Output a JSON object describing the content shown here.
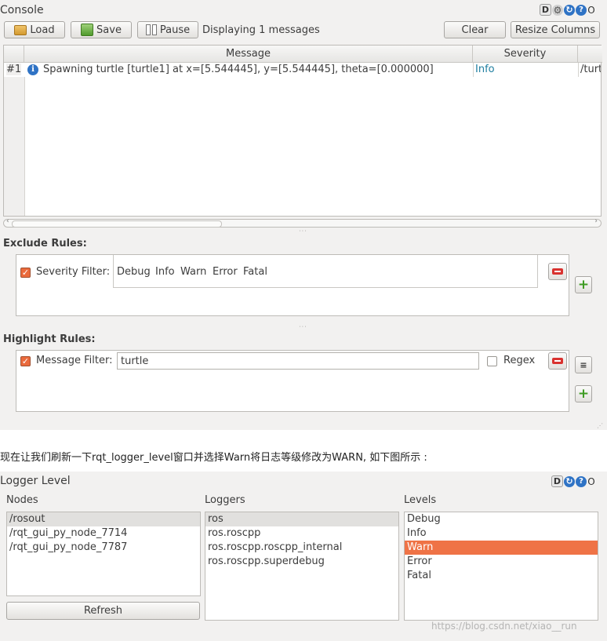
{
  "console": {
    "title": "Console",
    "buttons": {
      "load": "Load",
      "save": "Save",
      "pause": "Pause",
      "clear": "Clear",
      "resize": "Resize Columns"
    },
    "status": "Displaying 1 messages",
    "columns": {
      "message": "Message",
      "severity": "Severity"
    },
    "rows": [
      {
        "num": "#1",
        "message": "Spawning turtle [turtle1] at x=[5.544445], y=[5.544445], theta=[0.000000]",
        "severity": "Info",
        "node": "/turt"
      }
    ],
    "header_icons": {
      "d": "D",
      "gear": "gear-icon",
      "refresh": "refresh-icon",
      "help": "?",
      "close": "O"
    }
  },
  "exclude": {
    "label": "Exclude Rules:",
    "filter_label": "Severity Filter:",
    "levels": [
      "Debug",
      "Info",
      "Warn",
      "Error",
      "Fatal"
    ]
  },
  "highlight": {
    "label": "Highlight Rules:",
    "filter_label": "Message Filter:",
    "value": "turtle",
    "regex_label": "Regex"
  },
  "caption": "现在让我们刷新一下rqt_logger_level窗口并选择Warn将日志等级修改为WARN, 如下图所示 :",
  "logger": {
    "title": "Logger Level",
    "header_icons": {
      "d": "D",
      "refresh": "refresh-icon",
      "help": "?",
      "close": "O"
    },
    "nodes_label": "Nodes",
    "nodes": [
      "/rosout",
      "/rqt_gui_py_node_7714",
      "/rqt_gui_py_node_7787"
    ],
    "loggers_label": "Loggers",
    "loggers": [
      "ros",
      "ros.roscpp",
      "ros.roscpp.roscpp_internal",
      "ros.roscpp.superdebug"
    ],
    "levels_label": "Levels",
    "levels": [
      "Debug",
      "Info",
      "Warn",
      "Error",
      "Fatal"
    ],
    "refresh": "Refresh"
  },
  "watermark": "https://blog.csdn.net/xiao__run",
  "colors": {
    "accent": "#ef7346",
    "info": "#1e7ea0",
    "panel": "#f2f1f0"
  }
}
